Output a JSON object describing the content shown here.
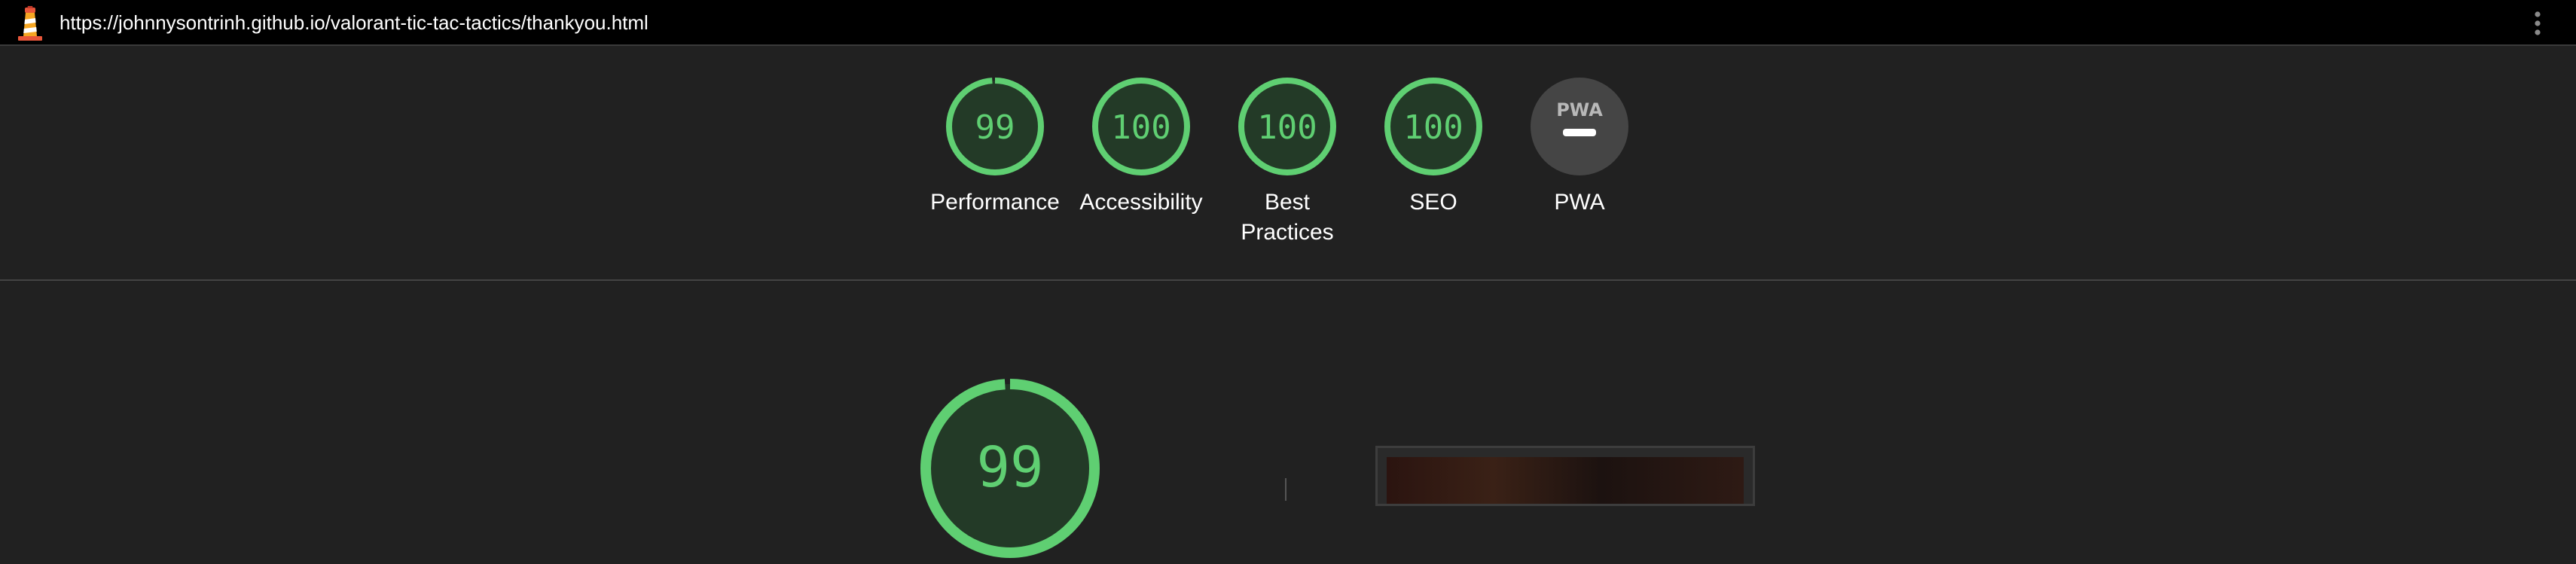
{
  "browser": {
    "url": "https://johnnysontrinh.github.io/valorant-tic-tac-tactics/thankyou.html",
    "logo_icon": "lighthouse-icon",
    "menu_icon": "vertical-dots-icon"
  },
  "categories": [
    {
      "id": "performance",
      "label": "Performance",
      "score": "99",
      "value": 99
    },
    {
      "id": "accessibility",
      "label": "Accessibility",
      "score": "100",
      "value": 100
    },
    {
      "id": "best-practices",
      "label": "Best Practices",
      "score": "100",
      "value": 100
    },
    {
      "id": "seo",
      "label": "SEO",
      "score": "100",
      "value": 100
    },
    {
      "id": "pwa",
      "label": "PWA",
      "badge": "PWA",
      "icon": "pwa-badge-icon"
    }
  ],
  "main": {
    "score": "99",
    "value": 99
  },
  "colors": {
    "pass": "#5fcf72",
    "pass_bg": "#233a27",
    "background": "#212121",
    "topbar": "#000000",
    "pwa_bg": "#454545"
  }
}
